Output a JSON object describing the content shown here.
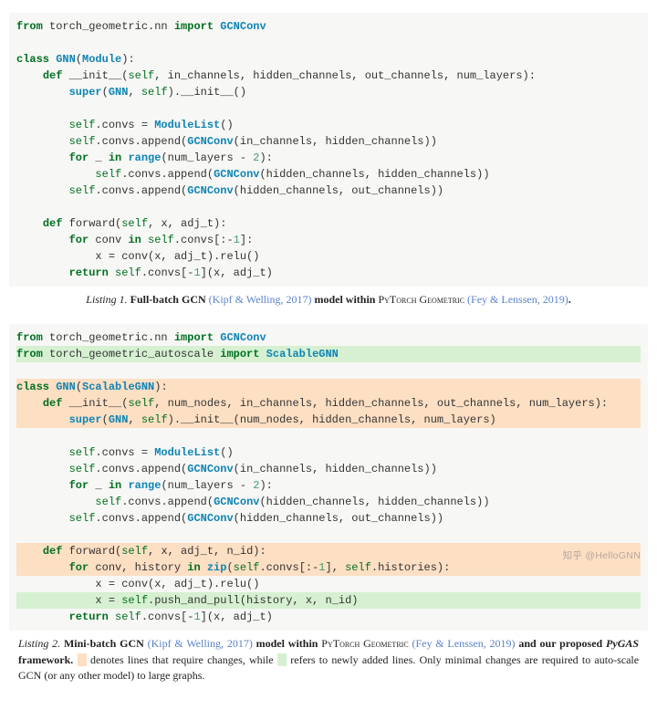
{
  "listing1": {
    "lines": [
      {
        "html": "<span class='kw'>from</span> torch_geometric.nn <span class='kw'>import</span> <span class='cls'>GCNConv</span>"
      },
      {
        "html": ""
      },
      {
        "html": "<span class='kw'>class</span> <span class='cls'>GNN</span>(<span class='cls'>Module</span>):"
      },
      {
        "html": "    <span class='kw'>def</span> __init__(<span class='self'>self</span>, in_channels, hidden_channels, out_channels, num_layers):"
      },
      {
        "html": "        <span class='cls'>super</span>(<span class='cls'>GNN</span>, <span class='self'>self</span>).__init__()"
      },
      {
        "html": ""
      },
      {
        "html": "        <span class='self'>self</span>.convs = <span class='cls'>ModuleList</span>()"
      },
      {
        "html": "        <span class='self'>self</span>.convs.append(<span class='cls'>GCNConv</span>(in_channels, hidden_channels))"
      },
      {
        "html": "        <span class='kw'>for</span> _ <span class='kw'>in</span> <span class='cls'>range</span>(num_layers - <span class='num'>2</span>):"
      },
      {
        "html": "            <span class='self'>self</span>.convs.append(<span class='cls'>GCNConv</span>(hidden_channels, hidden_channels))"
      },
      {
        "html": "        <span class='self'>self</span>.convs.append(<span class='cls'>GCNConv</span>(hidden_channels, out_channels))"
      },
      {
        "html": ""
      },
      {
        "html": "    <span class='kw'>def</span> forward(<span class='self'>self</span>, x, adj_t):"
      },
      {
        "html": "        <span class='kw'>for</span> conv <span class='kw'>in</span> <span class='self'>self</span>.convs[:-<span class='num'>1</span>]:"
      },
      {
        "html": "            x = conv(x, adj_t).relu()"
      },
      {
        "html": "        <span class='kw'>return</span> <span class='self'>self</span>.convs[-<span class='num'>1</span>](x, adj_t)"
      }
    ],
    "caption_prefix": "Listing 1.",
    "caption_bold1": "Full-batch GCN",
    "cite1": "(Kipf & Welling, 2017)",
    "caption_mid": "model within",
    "lib": "PyTorch Geometric",
    "cite2": "(Fey & Lenssen, 2019)",
    "caption_suffix": "."
  },
  "listing2": {
    "lines": [
      {
        "hl": "",
        "html": "<span class='kw'>from</span> torch_geometric.nn <span class='kw'>import</span> <span class='cls'>GCNConv</span>"
      },
      {
        "hl": "green",
        "html": "<span class='kw'>from</span> torch_geometric_autoscale <span class='kw'>import</span> <span class='cls'>ScalableGNN</span>"
      },
      {
        "hl": "",
        "html": ""
      },
      {
        "hl": "orange",
        "html": "<span class='kw'>class</span> <span class='cls'>GNN</span>(<span class='cls'>ScalableGNN</span>):"
      },
      {
        "hl": "orange",
        "html": "    <span class='kw'>def</span> __init__(<span class='self'>self</span>, num_nodes, in_channels, hidden_channels, out_channels, num_layers):"
      },
      {
        "hl": "orange",
        "html": "        <span class='cls'>super</span>(<span class='cls'>GNN</span>, <span class='self'>self</span>).__init__(num_nodes, hidden_channels, num_layers)"
      },
      {
        "hl": "",
        "html": ""
      },
      {
        "hl": "",
        "html": "        <span class='self'>self</span>.convs = <span class='cls'>ModuleList</span>()"
      },
      {
        "hl": "",
        "html": "        <span class='self'>self</span>.convs.append(<span class='cls'>GCNConv</span>(in_channels, hidden_channels))"
      },
      {
        "hl": "",
        "html": "        <span class='kw'>for</span> _ <span class='kw'>in</span> <span class='cls'>range</span>(num_layers - <span class='num'>2</span>):"
      },
      {
        "hl": "",
        "html": "            <span class='self'>self</span>.convs.append(<span class='cls'>GCNConv</span>(hidden_channels, hidden_channels))"
      },
      {
        "hl": "",
        "html": "        <span class='self'>self</span>.convs.append(<span class='cls'>GCNConv</span>(hidden_channels, out_channels))"
      },
      {
        "hl": "",
        "html": ""
      },
      {
        "hl": "orange",
        "html": "    <span class='kw'>def</span> forward(<span class='self'>self</span>, x, adj_t, n_id):"
      },
      {
        "hl": "orange",
        "html": "        <span class='kw'>for</span> conv, history <span class='kw'>in</span> <span class='cls'>zip</span>(<span class='self'>self</span>.convs[:-<span class='num'>1</span>], <span class='self'>self</span>.histories):"
      },
      {
        "hl": "",
        "html": "            x = conv(x, adj_t).relu()"
      },
      {
        "hl": "green",
        "html": "            x = <span class='self'>self</span>.push_and_pull(history, x, n_id)"
      },
      {
        "hl": "",
        "html": "        <span class='kw'>return</span> <span class='self'>self</span>.convs[-<span class='num'>1</span>](x, adj_t)"
      }
    ],
    "caption_prefix": "Listing 2.",
    "caption_bold1": "Mini-batch GCN",
    "cite1": "(Kipf & Welling, 2017)",
    "caption_mid1": "model within",
    "lib": "PyTorch Geometric",
    "cite2": "(Fey & Lenssen, 2019)",
    "caption_mid2": "and our proposed",
    "framework": "PyGAS",
    "caption_mid3": "framework.",
    "legend_orange": "denotes lines that require changes, while",
    "legend_green": "refers to newly added lines. Only minimal changes are required to auto-scale GCN (or any other model) to large graphs."
  },
  "watermark": "知乎 @HelloGNN"
}
